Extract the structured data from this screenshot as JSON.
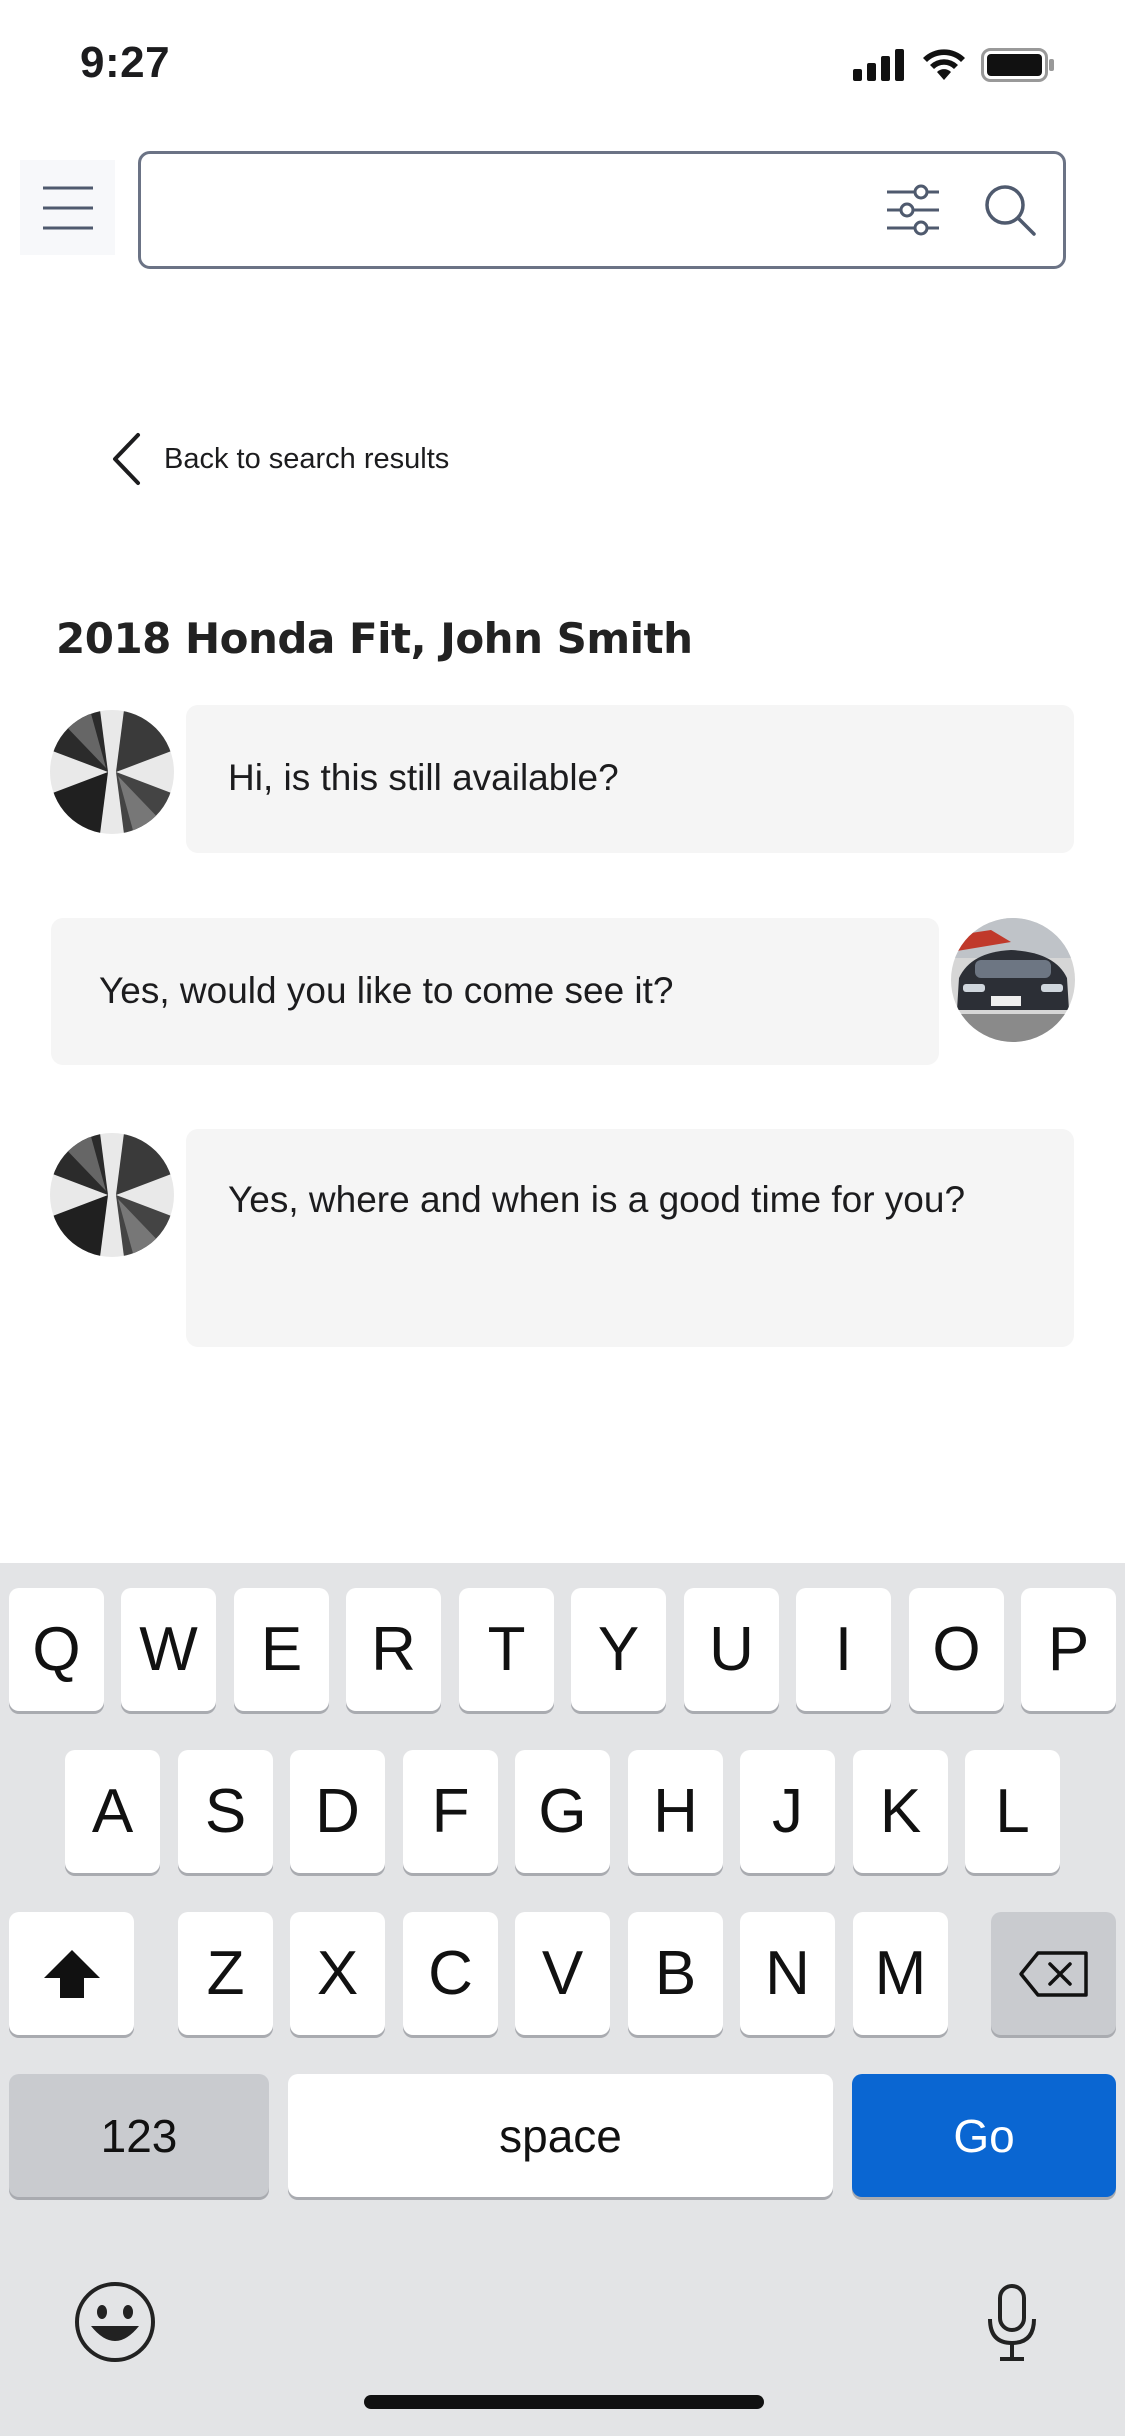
{
  "status_bar": {
    "time": "9:27",
    "icons": [
      "signal-icon",
      "wifi-icon",
      "battery-icon"
    ]
  },
  "top_bar": {
    "menu_icon": "hamburger-menu-icon",
    "search": {
      "value": "",
      "placeholder": ""
    },
    "filter_icon": "sliders-filter-icon",
    "search_icon": "magnifier-icon"
  },
  "back_link": {
    "label": "Back to search results"
  },
  "conversation": {
    "title": "2018 Honda Fit, John Smith",
    "messages": [
      {
        "side": "left",
        "avatar": "buildings-avatar",
        "text": "Hi, is this still available?"
      },
      {
        "side": "right",
        "avatar": "car-avatar",
        "text": "Yes, would you like to come see it?"
      },
      {
        "side": "left",
        "avatar": "buildings-avatar",
        "text": "Yes, where and when is a good time for you?"
      }
    ]
  },
  "keyboard": {
    "row1": [
      "Q",
      "W",
      "E",
      "R",
      "T",
      "Y",
      "U",
      "I",
      "O",
      "P"
    ],
    "row2": [
      "A",
      "S",
      "D",
      "F",
      "G",
      "H",
      "J",
      "K",
      "L"
    ],
    "row3": [
      "Z",
      "X",
      "C",
      "V",
      "B",
      "N",
      "M"
    ],
    "numbers_key": "123",
    "space_key": "space",
    "go_key": "Go",
    "shift_icon": "shift-icon",
    "delete_icon": "backspace-icon",
    "emoji_icon": "emoji-icon",
    "mic_icon": "microphone-icon"
  },
  "colors": {
    "go_key": "#0a66d2",
    "bubble_bg": "#f5f5f5",
    "keyboard_bg": "#e3e4e6",
    "search_border": "#6b7385"
  }
}
